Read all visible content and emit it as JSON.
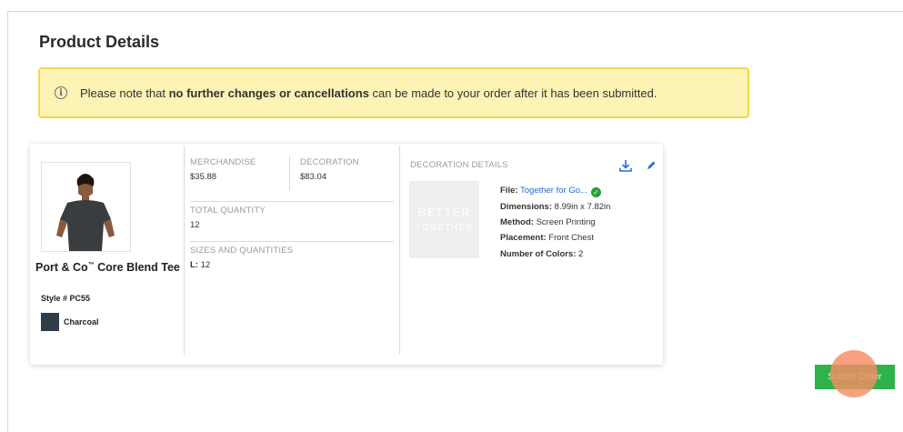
{
  "page": {
    "title": "Product Details"
  },
  "notice": {
    "icon": "info-icon",
    "prefix": "Please note that",
    "bold": "no further changes or cancellations",
    "suffix": "can be made to your order after it has been submitted."
  },
  "product": {
    "name": "Port & Co",
    "trademark": "™",
    "name_rest": "Core Blend Tee",
    "style": "Style # PC55",
    "color_name": "Charcoal",
    "color_hex": "#2f3c4a"
  },
  "pricing": {
    "merchandise_label": "MERCHANDISE",
    "merchandise_value": "$35.88",
    "decoration_label": "DECORATION",
    "decoration_value": "$83.04",
    "total_qty_label": "TOTAL QUANTITY",
    "total_qty_value": "12",
    "sizes_label": "SIZES AND QUANTITIES",
    "size_key": "L:",
    "size_value": "12"
  },
  "decoration": {
    "header": "DECORATION DETAILS",
    "thumb_lines": [
      "BETTER",
      "TOGETHER"
    ],
    "file_label": "File:",
    "file_value": "Together for Go...",
    "dimensions_label": "Dimensions:",
    "dimensions_value": "8.99in x 7.82in",
    "method_label": "Method:",
    "method_value": "Screen Printing",
    "placement_label": "Placement:",
    "placement_value": "Front Chest",
    "colors_label": "Number of Colors:",
    "colors_value": "2"
  },
  "actions": {
    "submit_label": "Submit Order"
  },
  "colors": {
    "notice_bg": "#fcf3b5",
    "notice_border": "#f2d64b",
    "submit": "#2fb24a",
    "link": "#1f6fd6"
  }
}
